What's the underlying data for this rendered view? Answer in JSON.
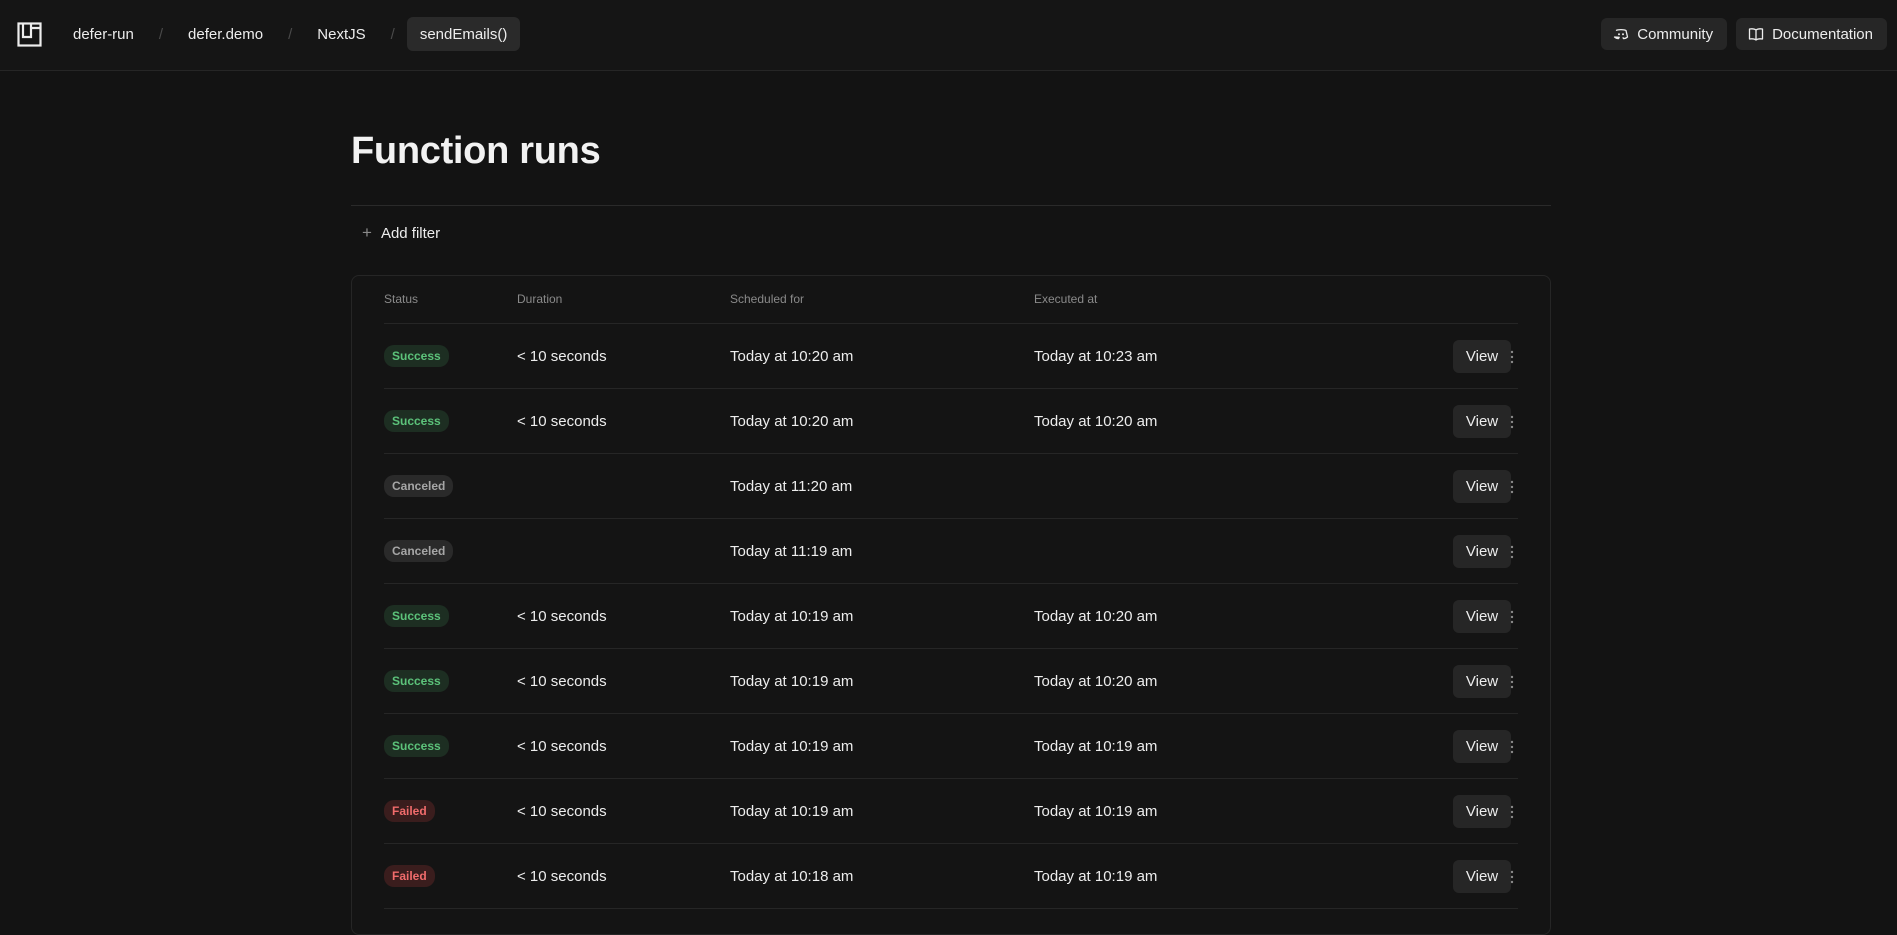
{
  "breadcrumbs": [
    {
      "label": "defer-run"
    },
    {
      "label": "defer.demo"
    },
    {
      "label": "NextJS"
    },
    {
      "label": "sendEmails()"
    }
  ],
  "actions": {
    "community": "Community",
    "documentation": "Documentation"
  },
  "page": {
    "title": "Function runs",
    "add_filter": "Add filter"
  },
  "table": {
    "columns": {
      "status": "Status",
      "duration": "Duration",
      "scheduled": "Scheduled for",
      "executed": "Executed at"
    },
    "view_label": "View",
    "rows": [
      {
        "status": "Success",
        "kind": "success",
        "duration": "< 10 seconds",
        "scheduled": "Today at 10:20 am",
        "executed": "Today at 10:23 am"
      },
      {
        "status": "Success",
        "kind": "success",
        "duration": "< 10 seconds",
        "scheduled": "Today at 10:20 am",
        "executed": "Today at 10:20 am"
      },
      {
        "status": "Canceled",
        "kind": "canceled",
        "duration": "",
        "scheduled": "Today at 11:20 am",
        "executed": ""
      },
      {
        "status": "Canceled",
        "kind": "canceled",
        "duration": "",
        "scheduled": "Today at 11:19 am",
        "executed": ""
      },
      {
        "status": "Success",
        "kind": "success",
        "duration": "< 10 seconds",
        "scheduled": "Today at 10:19 am",
        "executed": "Today at 10:20 am"
      },
      {
        "status": "Success",
        "kind": "success",
        "duration": "< 10 seconds",
        "scheduled": "Today at 10:19 am",
        "executed": "Today at 10:20 am"
      },
      {
        "status": "Success",
        "kind": "success",
        "duration": "< 10 seconds",
        "scheduled": "Today at 10:19 am",
        "executed": "Today at 10:19 am"
      },
      {
        "status": "Failed",
        "kind": "failed",
        "duration": "< 10 seconds",
        "scheduled": "Today at 10:19 am",
        "executed": "Today at 10:19 am"
      },
      {
        "status": "Failed",
        "kind": "failed",
        "duration": "< 10 seconds",
        "scheduled": "Today at 10:18 am",
        "executed": "Today at 10:19 am"
      }
    ]
  },
  "colors": {
    "background": "#131313",
    "success": "#5cc27a",
    "failed": "#f06b6b",
    "canceled": "#a6a6a6"
  },
  "icons": {
    "logo": "defer-logo-icon",
    "community": "discord-icon",
    "documentation": "book-icon",
    "add": "plus-icon",
    "row_menu": "more-vertical-icon"
  }
}
